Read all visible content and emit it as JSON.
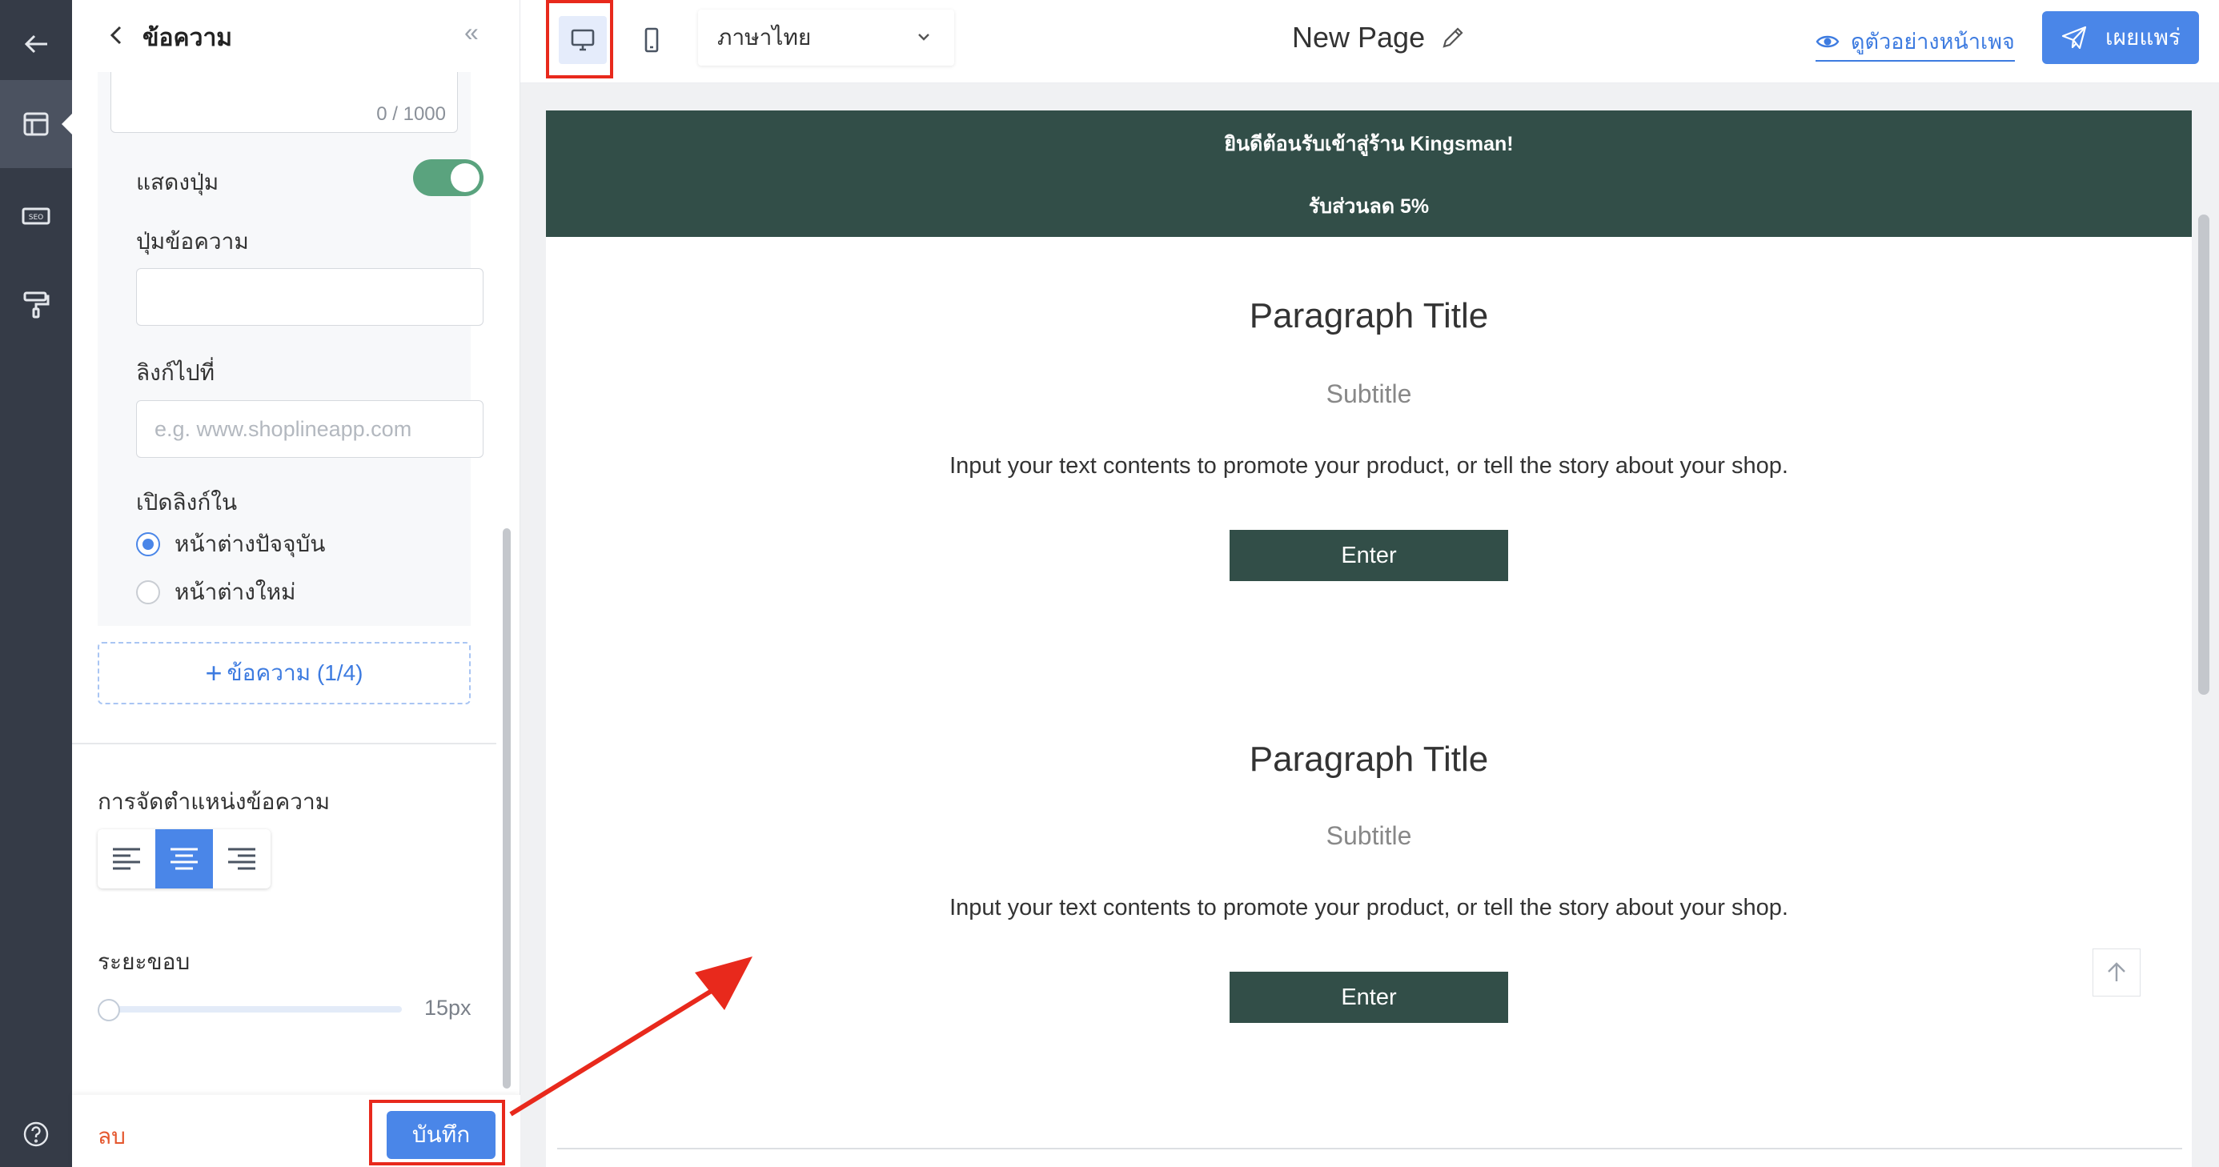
{
  "sidebar_rail": {
    "items": [
      "back-icon",
      "layout-icon",
      "seo-icon",
      "paint-roller-icon"
    ],
    "seo_text": "SEO",
    "help_icon": "help-icon"
  },
  "panel": {
    "title": "ข้อความ",
    "char_count": "0 / 1000",
    "show_button_label": "แสดงปุ่ม",
    "show_button_on": true,
    "button_text_label": "ปุ่มข้อความ",
    "button_text_value": "",
    "link_label": "ลิงก์ไปที่",
    "link_placeholder": "e.g. www.shoplineapp.com",
    "open_link_label": "เปิดลิงก์ใน",
    "radio_current": "หน้าต่างปัจจุบัน",
    "radio_new": "หน้าต่างใหม่",
    "add_text_button": "ข้อความ (1/4)",
    "alignment_label": "การจัดตำแหน่งข้อความ",
    "alignment_selected": "center",
    "padding_label": "ระยะขอบ",
    "padding_value": "15px",
    "padding_level": 0,
    "delete_label": "ลบ",
    "save_label": "บันทึก"
  },
  "topbar": {
    "language": "ภาษาไทย",
    "page_title": "New Page",
    "preview_label": "ดูตัวอย่างหน้าเพจ",
    "publish_label": "เผยแพร่"
  },
  "canvas": {
    "announcement_line1": "ยินดีต้อนรับเข้าสู่ร้าน Kingsman!",
    "announcement_line2": "รับส่วนลด 5%",
    "sections": [
      {
        "title": "Paragraph Title",
        "subtitle": "Subtitle",
        "body": "Input your text contents to promote your product, or tell the story about your shop.",
        "button": "Enter"
      },
      {
        "title": "Paragraph Title",
        "subtitle": "Subtitle",
        "body": "Input your text contents to promote your product, or tell the story about your shop.",
        "button": "Enter"
      }
    ]
  },
  "colors": {
    "rail_bg": "#353b47",
    "accent_blue": "#4a86e8",
    "brand_green": "#324e48",
    "toggle_green": "#5aa37e",
    "highlight_red": "#e8291c",
    "delete_red": "#e4572e"
  }
}
